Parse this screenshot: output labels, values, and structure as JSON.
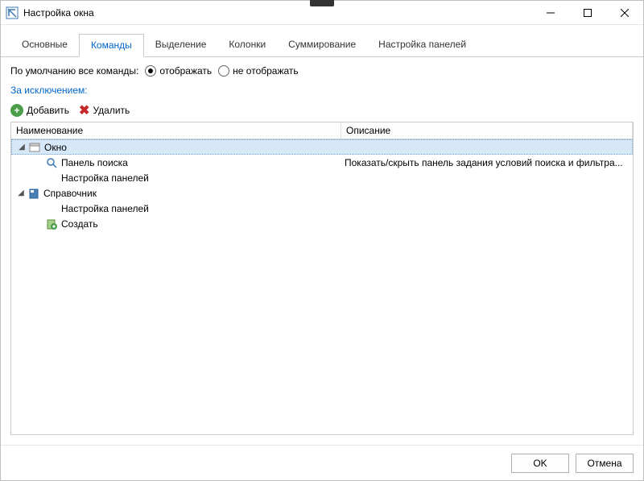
{
  "window": {
    "title": "Настройка окна"
  },
  "tabs": [
    {
      "label": "Основные",
      "active": false
    },
    {
      "label": "Команды",
      "active": true
    },
    {
      "label": "Выделение",
      "active": false
    },
    {
      "label": "Колонки",
      "active": false
    },
    {
      "label": "Суммирование",
      "active": false
    },
    {
      "label": "Настройка панелей",
      "active": false
    }
  ],
  "default_cmds_label": "По умолчанию все команды:",
  "radio": {
    "show": "отображать",
    "hide": "не отображать",
    "selected": "show"
  },
  "exception_label": "За исключением:",
  "toolbar": {
    "add": "Добавить",
    "delete": "Удалить"
  },
  "columns": {
    "name": "Наименование",
    "desc": "Описание"
  },
  "tree": [
    {
      "level": 0,
      "expander": true,
      "expanded": true,
      "icon": "window",
      "label": "Окно",
      "desc": "",
      "selected": true
    },
    {
      "level": 1,
      "expander": false,
      "icon": "search",
      "label": "Панель поиска",
      "desc": "Показать/скрыть панель задания условий поиска и фильтра..."
    },
    {
      "level": 1,
      "expander": false,
      "icon": "",
      "label": "Настройка панелей",
      "desc": ""
    },
    {
      "level": 0,
      "expander": true,
      "expanded": true,
      "icon": "book",
      "label": "Справочник",
      "desc": ""
    },
    {
      "level": 1,
      "expander": false,
      "icon": "",
      "label": "Настройка панелей",
      "desc": ""
    },
    {
      "level": 1,
      "expander": false,
      "icon": "create",
      "label": "Создать",
      "desc": ""
    }
  ],
  "buttons": {
    "ok": "OK",
    "cancel": "Отмена"
  }
}
